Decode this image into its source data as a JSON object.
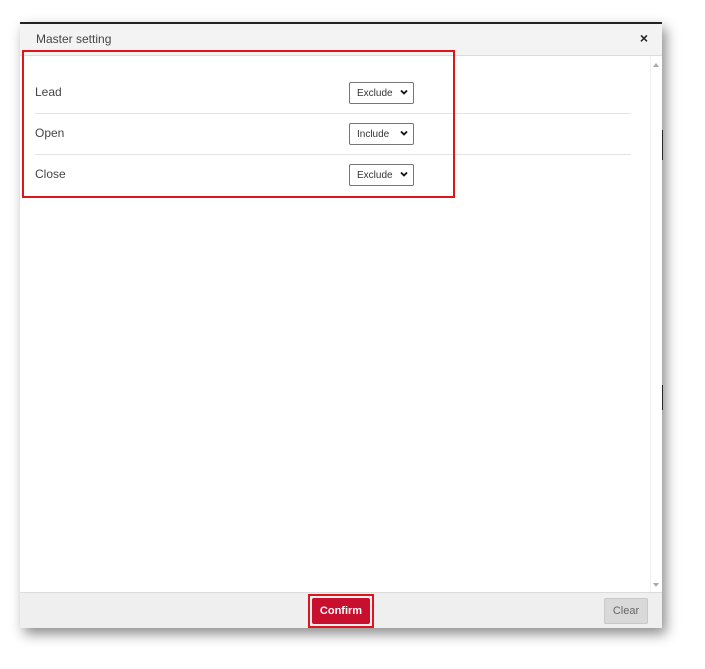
{
  "dialog": {
    "title": "Master setting",
    "close_label": "×"
  },
  "settings": [
    {
      "label": "Lead",
      "value": "Exclude"
    },
    {
      "label": "Open",
      "value": "Include"
    },
    {
      "label": "Close",
      "value": "Exclude"
    }
  ],
  "footer": {
    "confirm_label": "Confirm",
    "clear_label": "Clear"
  },
  "colors": {
    "accent": "#c8102e",
    "highlight": "#e0151c"
  },
  "icons": {
    "close": "close-icon",
    "dropdown": "chevron-down-icon"
  }
}
